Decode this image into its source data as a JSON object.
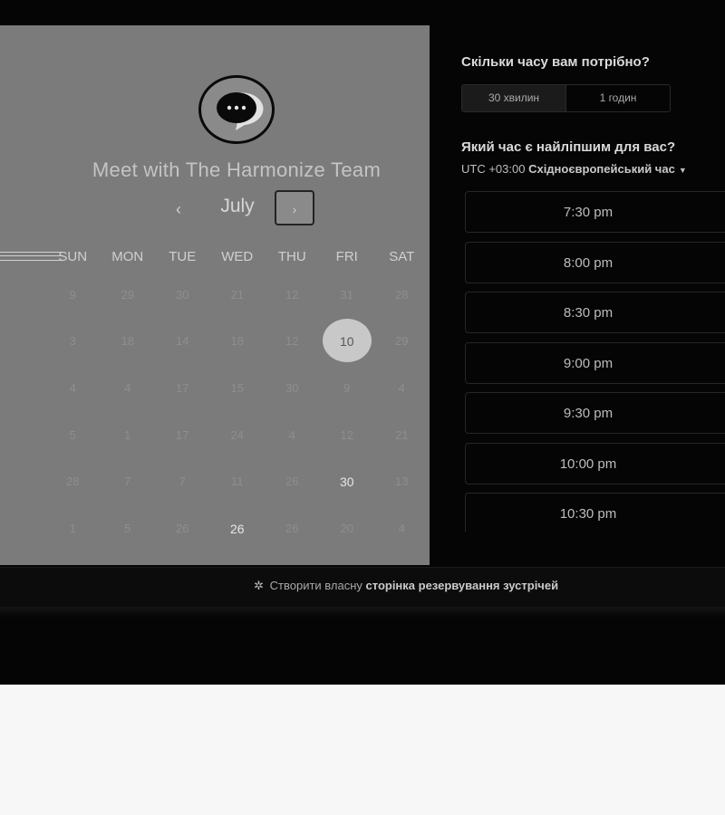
{
  "calendar": {
    "title": "Meet with The Harmonize Team",
    "month": "July",
    "prev_label": "‹",
    "next_label": "›",
    "weekdays": [
      "SUN",
      "MON",
      "TUE",
      "WED",
      "THU",
      "FRI",
      "SAT"
    ],
    "weeks": [
      [
        "9",
        "29",
        "30",
        "21",
        "12",
        "31",
        "28"
      ],
      [
        "3",
        "18",
        "14",
        "18",
        "12",
        "10",
        "29"
      ],
      [
        "4",
        "4",
        "17",
        "15",
        "30",
        "9",
        "4"
      ],
      [
        "5",
        "1",
        "17",
        "24",
        "4",
        "12",
        "21"
      ],
      [
        "28",
        "7",
        "7",
        "11",
        "26",
        "30",
        "13"
      ],
      [
        "1",
        "5",
        "26",
        "26",
        "26",
        "20",
        "4"
      ]
    ],
    "selected_day": "10",
    "available_days": [
      "30",
      "26"
    ]
  },
  "booking": {
    "duration_heading": "Скільки часу вам потрібно?",
    "durations": [
      "30 хвилин",
      "1 годин"
    ],
    "time_heading": "Який час є найліпшим для вас?",
    "timezone_offset": "UTC +03:00",
    "timezone_name": "Східноєвропейський час",
    "slots": [
      "7:30 pm",
      "8:00 pm",
      "8:30 pm",
      "9:00 pm",
      "9:30 pm",
      "10:00 pm",
      "10:30 pm"
    ]
  },
  "footer": {
    "prefix": "Створити власну",
    "link": "сторінка резервування зустрічей"
  },
  "icons": {
    "logo": "chat-bubble-icon",
    "footer": "hubspot-sprocket-icon",
    "tz_dropdown": "caret-down-icon"
  }
}
